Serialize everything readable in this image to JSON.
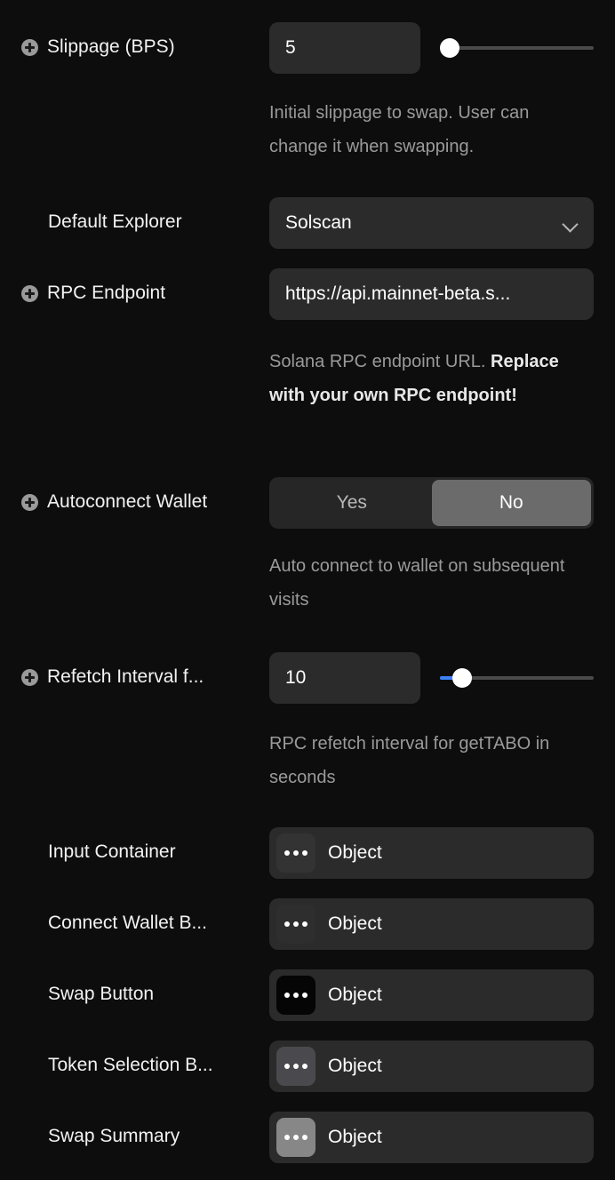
{
  "settings": {
    "slippage": {
      "label": "Slippage (BPS)",
      "has_expander": true,
      "value": "5",
      "description": "Initial slippage to swap. User can change it when swapping.",
      "slider": {
        "percent": 3,
        "fill_color": "#4a4a4a",
        "has_blue_fill": false
      }
    },
    "default_explorer": {
      "label": "Default Explorer",
      "has_expander": false,
      "value": "Solscan",
      "chevron": "chevron-down-icon"
    },
    "rpc_endpoint": {
      "label": "RPC Endpoint",
      "has_expander": true,
      "value": "https://api.mainnet-beta.s...",
      "description_normal": "Solana RPC endpoint URL. ",
      "description_strong": "Replace with your own RPC endpoint!"
    },
    "autoconnect_wallet": {
      "label": "Autoconnect Wallet",
      "has_expander": true,
      "options": [
        "Yes",
        "No"
      ],
      "selected": "No",
      "description": "Auto connect to wallet on subsequent visits"
    },
    "refetch_interval": {
      "label": "Refetch Interval f...",
      "has_expander": true,
      "value": "10",
      "description": "RPC refetch interval for getTABO in seconds",
      "slider": {
        "percent": 10,
        "fill_color": "#3b82f6",
        "has_blue_fill": true
      }
    }
  },
  "object_rows": [
    {
      "label": "Input Container",
      "value": "Object",
      "thumb_color": "#333333"
    },
    {
      "label": "Connect Wallet B...",
      "value": "Object",
      "thumb_color": "#2e2e2e"
    },
    {
      "label": "Swap Button",
      "value": "Object",
      "thumb_color": "#050505"
    },
    {
      "label": "Token Selection B...",
      "value": "Object",
      "thumb_color": "#4a4a4e"
    },
    {
      "label": "Swap Summary",
      "value": "Object",
      "thumb_color": "#878787"
    }
  ],
  "colors": {
    "background": "#0d0d0d",
    "field": "#2b2b2b",
    "accent": "#3b82f6",
    "text": "#ffffff",
    "muted": "#9a9a9a"
  }
}
